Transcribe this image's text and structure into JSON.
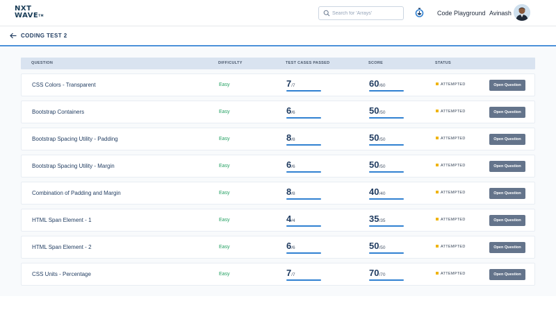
{
  "header": {
    "logo": {
      "line1": "NXT",
      "line2": "WAVE",
      "tm": "TM"
    },
    "search": {
      "placeholder": "Search for 'Arrays'",
      "value": ""
    },
    "code_playground": "Code Playground",
    "username": "Avinash",
    "icons": {
      "search": "search-icon",
      "timer": "timer-icon",
      "avatar": "user-avatar"
    }
  },
  "subheader": {
    "back_icon": "arrow-left-icon",
    "title": "CODING TEST 2"
  },
  "table": {
    "columns": [
      "QUESTION",
      "DIFFICULTY",
      "TEST CASES PASSED",
      "SCORE",
      "STATUS"
    ],
    "rows": [
      {
        "question": "CSS Colors - Transparent",
        "difficulty": "Easy",
        "passed": "7",
        "total": "/7",
        "score": "60",
        "max": "/60",
        "fill": 1.0,
        "score_fill": 1.0,
        "status": "ATTEMPTED",
        "action": "Open Question"
      },
      {
        "question": "Bootstrap Containers",
        "difficulty": "Easy",
        "passed": "6",
        "total": "/6",
        "score": "50",
        "max": "/50",
        "fill": 1.0,
        "score_fill": 1.0,
        "status": "ATTEMPTED",
        "action": "Open Question"
      },
      {
        "question": "Bootstrap Spacing Utility - Padding",
        "difficulty": "Easy",
        "passed": "8",
        "total": "/8",
        "score": "50",
        "max": "/50",
        "fill": 1.0,
        "score_fill": 1.0,
        "status": "ATTEMPTED",
        "action": "Open Question"
      },
      {
        "question": "Bootstrap Spacing Utility - Margin",
        "difficulty": "Easy",
        "passed": "6",
        "total": "/6",
        "score": "50",
        "max": "/50",
        "fill": 1.0,
        "score_fill": 1.0,
        "status": "ATTEMPTED",
        "action": "Open Question"
      },
      {
        "question": "Combination of Padding and Margin",
        "difficulty": "Easy",
        "passed": "8",
        "total": "/8",
        "score": "40",
        "max": "/40",
        "fill": 1.0,
        "score_fill": 1.0,
        "status": "ATTEMPTED",
        "action": "Open Question"
      },
      {
        "question": "HTML Span Element - 1",
        "difficulty": "Easy",
        "passed": "4",
        "total": "/4",
        "score": "35",
        "max": "/35",
        "fill": 1.0,
        "score_fill": 1.0,
        "status": "ATTEMPTED",
        "action": "Open Question"
      },
      {
        "question": "HTML Span Element - 2",
        "difficulty": "Easy",
        "passed": "6",
        "total": "/6",
        "score": "50",
        "max": "/50",
        "fill": 1.0,
        "score_fill": 1.0,
        "status": "ATTEMPTED",
        "action": "Open Question"
      },
      {
        "question": "CSS Units - Percentage",
        "difficulty": "Easy",
        "passed": "7",
        "total": "/7",
        "score": "70",
        "max": "/70",
        "fill": 1.0,
        "score_fill": 1.0,
        "status": "ATTEMPTED",
        "action": "Open Question"
      }
    ]
  },
  "colors": {
    "accent": "#2f80d1",
    "easy": "#22a061",
    "attempted_dot": "#f0b400",
    "button": "#64748b",
    "table_header": "#d9e3f0",
    "title": "#1e3a5f"
  }
}
